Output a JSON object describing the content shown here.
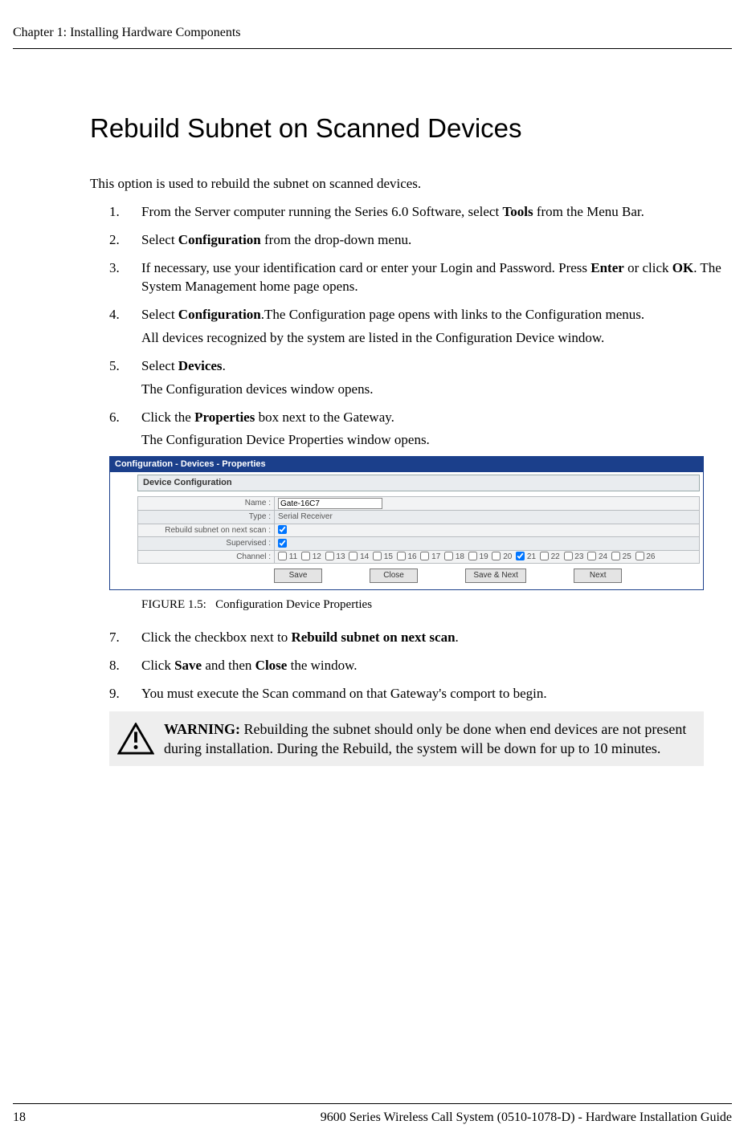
{
  "running_head": "Chapter 1: Installing Hardware Components",
  "section_title": "Rebuild Subnet on Scanned Devices",
  "intro": "This option is used to rebuild the subnet on scanned devices.",
  "steps": {
    "s1": {
      "num": "1.",
      "pre": "From the Server computer running the Series 6.0 Software, select ",
      "b1": "Tools",
      "post": " from the Menu Bar."
    },
    "s2": {
      "num": "2.",
      "pre": "Select ",
      "b1": "Configuration",
      "post": " from the drop-down menu."
    },
    "s3": {
      "num": "3.",
      "pre": "If necessary, use your identification card or enter your Login and Password. Press ",
      "b1": "Enter",
      "mid": " or click ",
      "b2": "OK",
      "post": ". The System Management home page opens."
    },
    "s4": {
      "num": "4.",
      "pre": "Select ",
      "b1": "Configuration",
      "post": ".The Configuration page opens with links to the Configuration menus.",
      "sub": "All devices recognized by the system are listed in the Configuration Device window."
    },
    "s5": {
      "num": "5.",
      "pre": "Select ",
      "b1": "Devices",
      "post": ".",
      "sub": "The Configuration devices window opens."
    },
    "s6": {
      "num": "6.",
      "pre": "Click the ",
      "b1": "Properties",
      "post": " box next to the Gateway.",
      "sub": "The Configuration Device Properties window opens."
    },
    "s7": {
      "num": "7.",
      "pre": "Click the checkbox next to ",
      "b1": "Rebuild subnet on next scan",
      "post": "."
    },
    "s8": {
      "num": "8.",
      "pre": "Click ",
      "b1": "Save",
      "mid": " and then ",
      "b2": "Close",
      "post": " the window."
    },
    "s9": {
      "num": "9.",
      "text": "You must execute the Scan command on that Gateway's comport to begin."
    }
  },
  "dialog": {
    "title": "Configuration - Devices - Properties",
    "subtitle": "Device Configuration",
    "rows": {
      "name_label": "Name :",
      "name_value": "Gate-16C7",
      "type_label": "Type :",
      "type_value": "Serial Receiver",
      "rebuild_label": "Rebuild subnet on next scan :",
      "supervised_label": "Supervised :",
      "channel_label": "Channel :"
    },
    "channels": [
      "11",
      "12",
      "13",
      "14",
      "15",
      "16",
      "17",
      "18",
      "19",
      "20",
      "21",
      "22",
      "23",
      "24",
      "25",
      "26"
    ],
    "channel_checked": "21",
    "buttons": {
      "save": "Save",
      "close": "Close",
      "save_next": "Save & Next",
      "next": "Next"
    }
  },
  "figure_caption": {
    "label": "FIGURE 1.5:",
    "text": "Configuration Device Properties"
  },
  "warning": {
    "label": "WARNING:",
    "text": " Rebuilding the subnet should only be done when end devices are not present during installation. During the Rebuild, the system will be down for up to 10 minutes."
  },
  "footer": {
    "page": "18",
    "text": "9600 Series Wireless Call System (0510-1078-D) - Hardware Installation Guide"
  }
}
